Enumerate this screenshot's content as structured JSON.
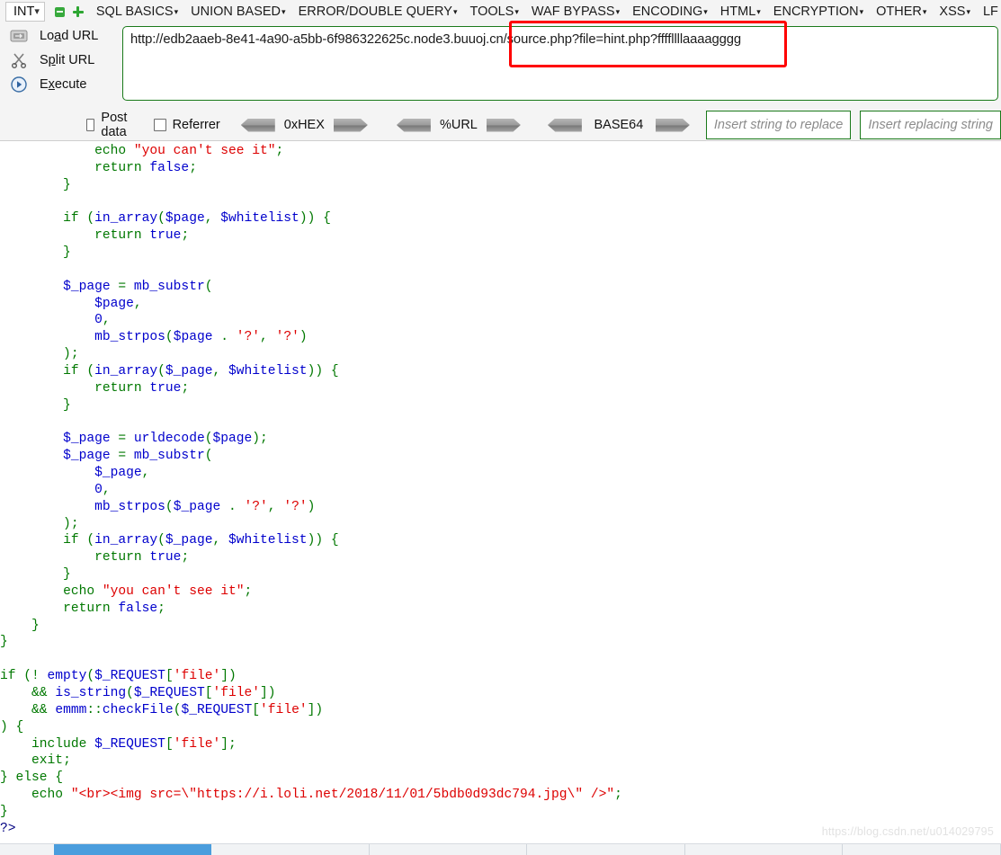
{
  "toolbar": {
    "type_selector": {
      "value": "INT",
      "chevron": "chevron-down-icon"
    },
    "zoom_out_icon": "minus-square-icon",
    "zoom_in_icon": "plus-icon",
    "menu_items": [
      {
        "label": "SQL BASICS",
        "caret": "▾"
      },
      {
        "label": "UNION BASED",
        "caret": "▾"
      },
      {
        "label": "ERROR/DOUBLE QUERY",
        "caret": "▾"
      },
      {
        "label": "TOOLS",
        "caret": "▾"
      },
      {
        "label": "WAF BYPASS",
        "caret": "▾"
      },
      {
        "label": "ENCODING",
        "caret": "▾"
      },
      {
        "label": "HTML",
        "caret": "▾"
      },
      {
        "label": "ENCRYPTION",
        "caret": "▾"
      },
      {
        "label": "OTHER",
        "caret": "▾"
      },
      {
        "label": "XSS",
        "caret": "▾"
      },
      {
        "label": "LF",
        "caret": ""
      }
    ]
  },
  "actions": [
    {
      "icon": "load-url-icon",
      "pre": "Lo",
      "accel": "a",
      "post": "d URL"
    },
    {
      "icon": "split-url-icon",
      "pre": "S",
      "accel": "p",
      "post": "lit URL"
    },
    {
      "icon": "execute-icon",
      "pre": "E",
      "accel": "x",
      "post": "ecute"
    }
  ],
  "url_field": {
    "value": "http://edb2aaeb-8e41-4a90-a5bb-6f986322625c.node3.buuoj.cn/source.php?file=hint.php?ffffllllaaaagggg",
    "highlighted_part": "/source.php?file=hint.php?ffffllllaaaagggg",
    "highlight_color": "#ff0000",
    "border_color": "#1a7a1a"
  },
  "options": {
    "checkboxes": [
      {
        "label": "Post data",
        "checked": false
      },
      {
        "label": "Referrer",
        "checked": false
      }
    ],
    "encoders": [
      {
        "label": "0xHEX"
      },
      {
        "label": "%URL"
      },
      {
        "label": "BASE64"
      }
    ],
    "replace_input_placeholder": "Insert string to replace",
    "replacing_input_placeholder": "Insert replacing string"
  },
  "code": {
    "lines": [
      [
        {
          "t": "            ",
          "c": ""
        },
        {
          "t": "echo",
          "c": "k"
        },
        {
          "t": " ",
          "c": ""
        },
        {
          "t": "\"you can't see it\"",
          "c": "s"
        },
        {
          "t": ";",
          "c": "p"
        }
      ],
      [
        {
          "t": "            ",
          "c": ""
        },
        {
          "t": "return",
          "c": "k"
        },
        {
          "t": " ",
          "c": ""
        },
        {
          "t": "false",
          "c": "v"
        },
        {
          "t": ";",
          "c": "p"
        }
      ],
      [
        {
          "t": "        }",
          "c": "p"
        }
      ],
      [
        {
          "t": "",
          "c": ""
        }
      ],
      [
        {
          "t": "        ",
          "c": ""
        },
        {
          "t": "if",
          "c": "k"
        },
        {
          "t": " (",
          "c": "p"
        },
        {
          "t": "in_array",
          "c": "v"
        },
        {
          "t": "(",
          "c": "p"
        },
        {
          "t": "$page",
          "c": "v"
        },
        {
          "t": ", ",
          "c": "p"
        },
        {
          "t": "$whitelist",
          "c": "v"
        },
        {
          "t": ")) {",
          "c": "p"
        }
      ],
      [
        {
          "t": "            ",
          "c": ""
        },
        {
          "t": "return",
          "c": "k"
        },
        {
          "t": " ",
          "c": ""
        },
        {
          "t": "true",
          "c": "v"
        },
        {
          "t": ";",
          "c": "p"
        }
      ],
      [
        {
          "t": "        }",
          "c": "p"
        }
      ],
      [
        {
          "t": "",
          "c": ""
        }
      ],
      [
        {
          "t": "        ",
          "c": ""
        },
        {
          "t": "$_page",
          "c": "v"
        },
        {
          "t": " = ",
          "c": "p"
        },
        {
          "t": "mb_substr",
          "c": "v"
        },
        {
          "t": "(",
          "c": "p"
        }
      ],
      [
        {
          "t": "            ",
          "c": ""
        },
        {
          "t": "$page",
          "c": "v"
        },
        {
          "t": ",",
          "c": "p"
        }
      ],
      [
        {
          "t": "            ",
          "c": ""
        },
        {
          "t": "0",
          "c": "n"
        },
        {
          "t": ",",
          "c": "p"
        }
      ],
      [
        {
          "t": "            ",
          "c": ""
        },
        {
          "t": "mb_strpos",
          "c": "v"
        },
        {
          "t": "(",
          "c": "p"
        },
        {
          "t": "$page",
          "c": "v"
        },
        {
          "t": " . ",
          "c": "p"
        },
        {
          "t": "'?'",
          "c": "s"
        },
        {
          "t": ", ",
          "c": "p"
        },
        {
          "t": "'?'",
          "c": "s"
        },
        {
          "t": ")",
          "c": "p"
        }
      ],
      [
        {
          "t": "        );",
          "c": "p"
        }
      ],
      [
        {
          "t": "        ",
          "c": ""
        },
        {
          "t": "if",
          "c": "k"
        },
        {
          "t": " (",
          "c": "p"
        },
        {
          "t": "in_array",
          "c": "v"
        },
        {
          "t": "(",
          "c": "p"
        },
        {
          "t": "$_page",
          "c": "v"
        },
        {
          "t": ", ",
          "c": "p"
        },
        {
          "t": "$whitelist",
          "c": "v"
        },
        {
          "t": ")) {",
          "c": "p"
        }
      ],
      [
        {
          "t": "            ",
          "c": ""
        },
        {
          "t": "return",
          "c": "k"
        },
        {
          "t": " ",
          "c": ""
        },
        {
          "t": "true",
          "c": "v"
        },
        {
          "t": ";",
          "c": "p"
        }
      ],
      [
        {
          "t": "        }",
          "c": "p"
        }
      ],
      [
        {
          "t": "",
          "c": ""
        }
      ],
      [
        {
          "t": "        ",
          "c": ""
        },
        {
          "t": "$_page",
          "c": "v"
        },
        {
          "t": " = ",
          "c": "p"
        },
        {
          "t": "urldecode",
          "c": "v"
        },
        {
          "t": "(",
          "c": "p"
        },
        {
          "t": "$page",
          "c": "v"
        },
        {
          "t": ");",
          "c": "p"
        }
      ],
      [
        {
          "t": "        ",
          "c": ""
        },
        {
          "t": "$_page",
          "c": "v"
        },
        {
          "t": " = ",
          "c": "p"
        },
        {
          "t": "mb_substr",
          "c": "v"
        },
        {
          "t": "(",
          "c": "p"
        }
      ],
      [
        {
          "t": "            ",
          "c": ""
        },
        {
          "t": "$_page",
          "c": "v"
        },
        {
          "t": ",",
          "c": "p"
        }
      ],
      [
        {
          "t": "            ",
          "c": ""
        },
        {
          "t": "0",
          "c": "n"
        },
        {
          "t": ",",
          "c": "p"
        }
      ],
      [
        {
          "t": "            ",
          "c": ""
        },
        {
          "t": "mb_strpos",
          "c": "v"
        },
        {
          "t": "(",
          "c": "p"
        },
        {
          "t": "$_page",
          "c": "v"
        },
        {
          "t": " . ",
          "c": "p"
        },
        {
          "t": "'?'",
          "c": "s"
        },
        {
          "t": ", ",
          "c": "p"
        },
        {
          "t": "'?'",
          "c": "s"
        },
        {
          "t": ")",
          "c": "p"
        }
      ],
      [
        {
          "t": "        );",
          "c": "p"
        }
      ],
      [
        {
          "t": "        ",
          "c": ""
        },
        {
          "t": "if",
          "c": "k"
        },
        {
          "t": " (",
          "c": "p"
        },
        {
          "t": "in_array",
          "c": "v"
        },
        {
          "t": "(",
          "c": "p"
        },
        {
          "t": "$_page",
          "c": "v"
        },
        {
          "t": ", ",
          "c": "p"
        },
        {
          "t": "$whitelist",
          "c": "v"
        },
        {
          "t": ")) {",
          "c": "p"
        }
      ],
      [
        {
          "t": "            ",
          "c": ""
        },
        {
          "t": "return",
          "c": "k"
        },
        {
          "t": " ",
          "c": ""
        },
        {
          "t": "true",
          "c": "v"
        },
        {
          "t": ";",
          "c": "p"
        }
      ],
      [
        {
          "t": "        }",
          "c": "p"
        }
      ],
      [
        {
          "t": "        ",
          "c": ""
        },
        {
          "t": "echo",
          "c": "k"
        },
        {
          "t": " ",
          "c": ""
        },
        {
          "t": "\"you can't see it\"",
          "c": "s"
        },
        {
          "t": ";",
          "c": "p"
        }
      ],
      [
        {
          "t": "        ",
          "c": ""
        },
        {
          "t": "return",
          "c": "k"
        },
        {
          "t": " ",
          "c": ""
        },
        {
          "t": "false",
          "c": "v"
        },
        {
          "t": ";",
          "c": "p"
        }
      ],
      [
        {
          "t": "    }",
          "c": "p"
        }
      ],
      [
        {
          "t": "}",
          "c": "p"
        }
      ],
      [
        {
          "t": "",
          "c": ""
        }
      ],
      [
        {
          "t": "",
          "c": ""
        },
        {
          "t": "if",
          "c": "k"
        },
        {
          "t": " (! ",
          "c": "p"
        },
        {
          "t": "empty",
          "c": "v"
        },
        {
          "t": "(",
          "c": "p"
        },
        {
          "t": "$_REQUEST",
          "c": "v"
        },
        {
          "t": "[",
          "c": "p"
        },
        {
          "t": "'file'",
          "c": "s"
        },
        {
          "t": "])",
          "c": "p"
        }
      ],
      [
        {
          "t": "    && ",
          "c": "p"
        },
        {
          "t": "is_string",
          "c": "v"
        },
        {
          "t": "(",
          "c": "p"
        },
        {
          "t": "$_REQUEST",
          "c": "v"
        },
        {
          "t": "[",
          "c": "p"
        },
        {
          "t": "'file'",
          "c": "s"
        },
        {
          "t": "])",
          "c": "p"
        }
      ],
      [
        {
          "t": "    && ",
          "c": "p"
        },
        {
          "t": "emmm",
          "c": "v"
        },
        {
          "t": "::",
          "c": "p"
        },
        {
          "t": "checkFile",
          "c": "v"
        },
        {
          "t": "(",
          "c": "p"
        },
        {
          "t": "$_REQUEST",
          "c": "v"
        },
        {
          "t": "[",
          "c": "p"
        },
        {
          "t": "'file'",
          "c": "s"
        },
        {
          "t": "])",
          "c": "p"
        }
      ],
      [
        {
          "t": ") {",
          "c": "p"
        }
      ],
      [
        {
          "t": "    ",
          "c": ""
        },
        {
          "t": "include",
          "c": "k"
        },
        {
          "t": " ",
          "c": ""
        },
        {
          "t": "$_REQUEST",
          "c": "v"
        },
        {
          "t": "[",
          "c": "p"
        },
        {
          "t": "'file'",
          "c": "s"
        },
        {
          "t": "];",
          "c": "p"
        }
      ],
      [
        {
          "t": "    ",
          "c": ""
        },
        {
          "t": "exit",
          "c": "k"
        },
        {
          "t": ";",
          "c": "p"
        }
      ],
      [
        {
          "t": "} ",
          "c": "p"
        },
        {
          "t": "else",
          "c": "k"
        },
        {
          "t": " {",
          "c": "p"
        }
      ],
      [
        {
          "t": "    ",
          "c": ""
        },
        {
          "t": "echo",
          "c": "k"
        },
        {
          "t": " ",
          "c": ""
        },
        {
          "t": "\"<br><img src=\\\"https://i.loli.net/2018/11/01/5bdb0d93dc794.jpg\\\" />\"",
          "c": "s"
        },
        {
          "t": ";",
          "c": "p"
        }
      ],
      [
        {
          "t": "}",
          "c": "p"
        }
      ],
      [
        {
          "t": "?>",
          "c": "tag"
        }
      ]
    ]
  },
  "watermark": {
    "text": "https://blog.csdn.net/u014029795"
  },
  "taskbar": {
    "segments": 6,
    "active_index": 0
  }
}
